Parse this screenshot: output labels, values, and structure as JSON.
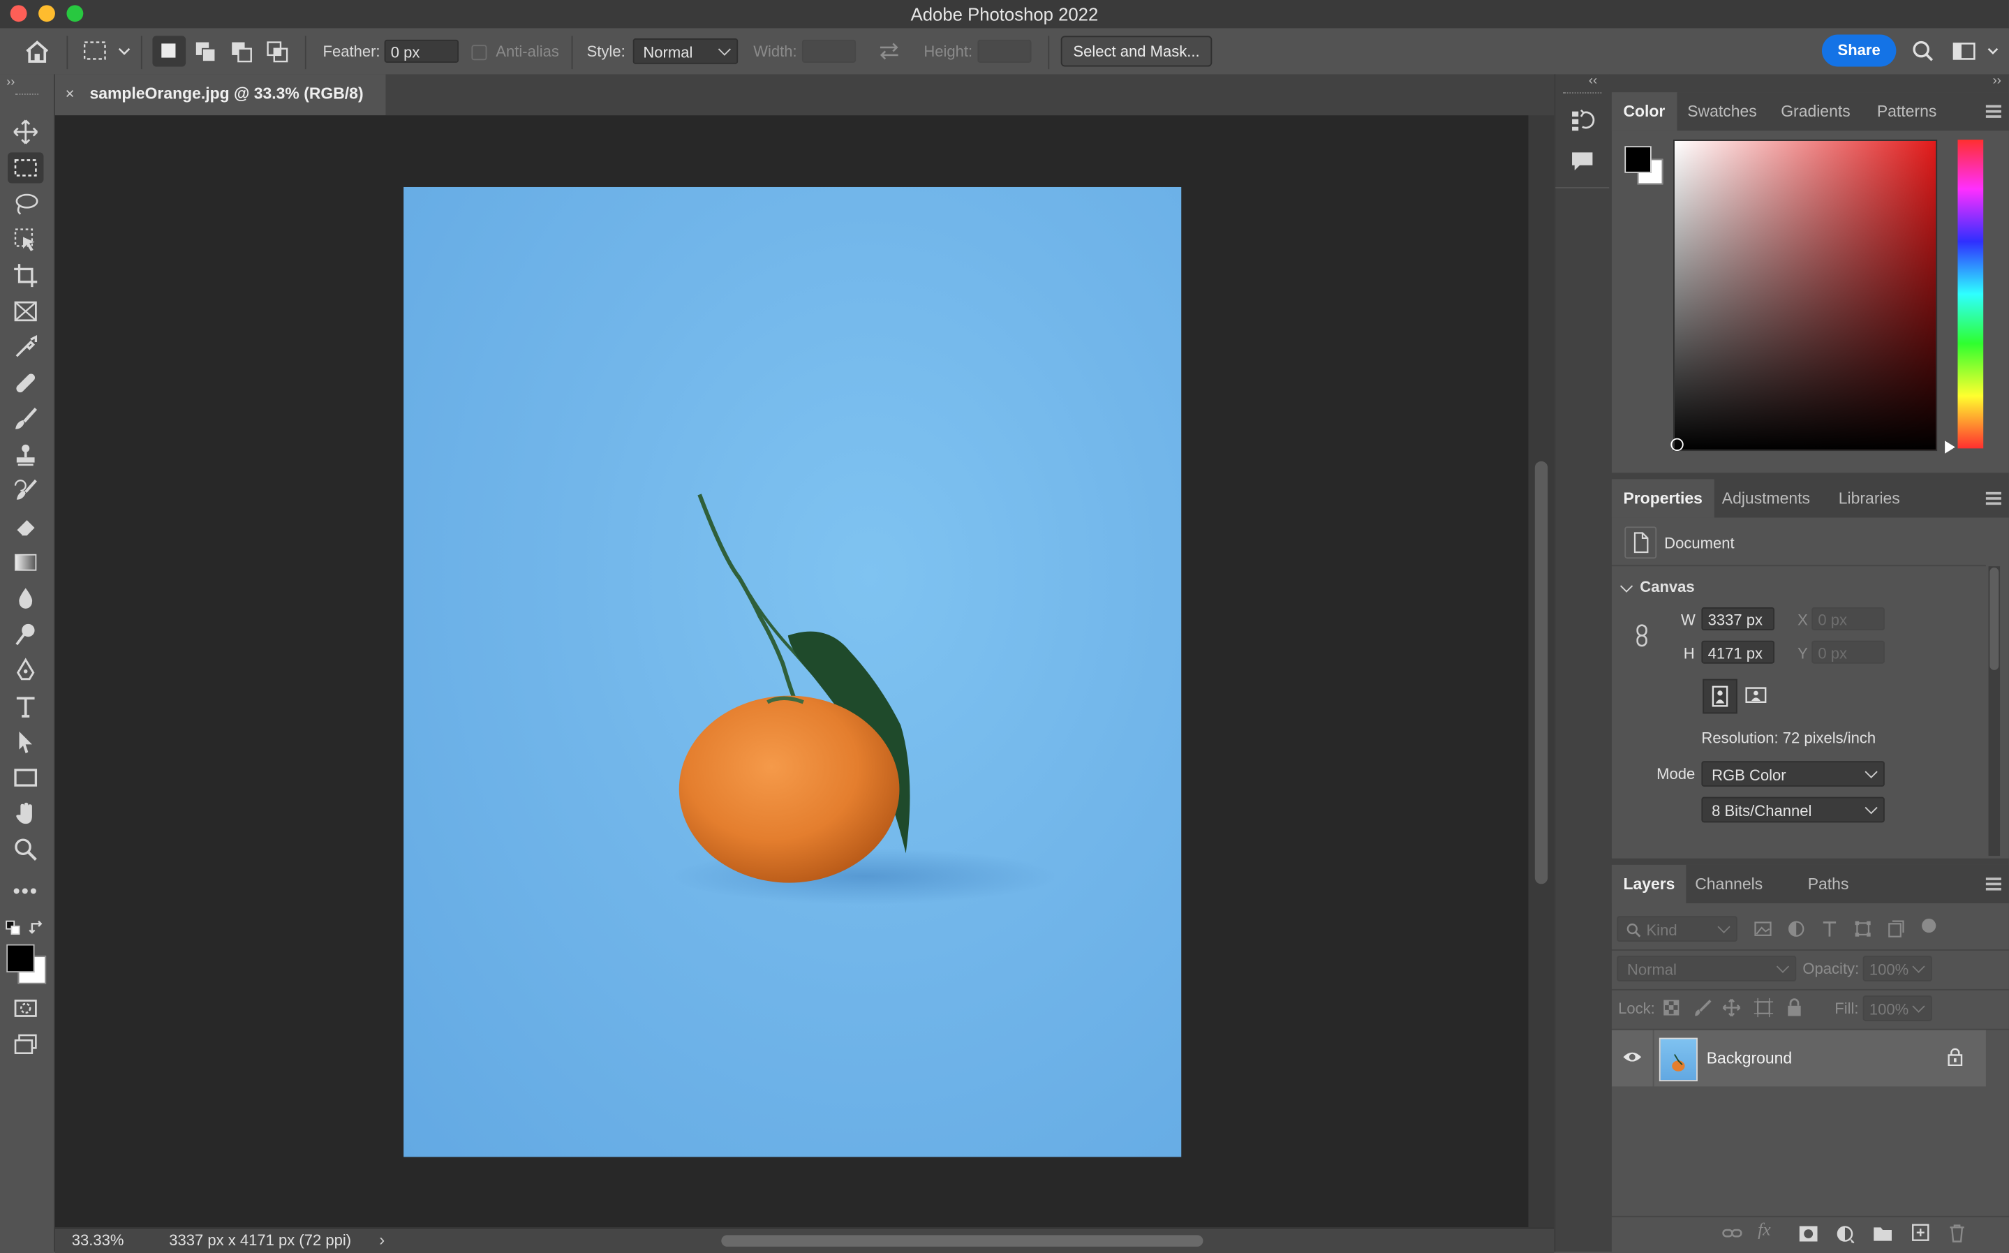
{
  "app_title": "Adobe Photoshop 2022",
  "options_bar": {
    "feather_label": "Feather:",
    "feather_value": "0 px",
    "anti_alias_label": "Anti-alias",
    "style_label": "Style:",
    "style_value": "Normal",
    "width_label": "Width:",
    "height_label": "Height:",
    "select_and_mask": "Select and Mask...",
    "share": "Share"
  },
  "document": {
    "tab_title": "sampleOrange.jpg @ 33.3% (RGB/8)",
    "zoom": "33.33%",
    "doc_info": "3337 px x 4171 px (72 ppi)"
  },
  "color_panel": {
    "tabs": [
      "Color",
      "Swatches",
      "Gradients",
      "Patterns"
    ]
  },
  "properties_panel": {
    "tabs": [
      "Properties",
      "Adjustments",
      "Libraries"
    ],
    "document_label": "Document",
    "canvas_label": "Canvas",
    "w_label": "W",
    "w_value": "3337 px",
    "h_label": "H",
    "h_value": "4171 px",
    "x_label": "X",
    "x_placeholder": "0 px",
    "y_label": "Y",
    "y_placeholder": "0 px",
    "resolution": "Resolution: 72 pixels/inch",
    "mode_label": "Mode",
    "mode_value": "RGB Color",
    "bits_value": "8 Bits/Channel"
  },
  "layers_panel": {
    "tabs": [
      "Layers",
      "Channels",
      "Paths"
    ],
    "kind_placeholder": "Kind",
    "blend_mode": "Normal",
    "opacity_label": "Opacity:",
    "opacity_value": "100%",
    "lock_label": "Lock:",
    "fill_label": "Fill:",
    "fill_value": "100%",
    "layers": [
      {
        "name": "Background",
        "visible": true,
        "locked": true
      }
    ]
  },
  "colors": {
    "accent": "#1473e6",
    "foreground": "#000000",
    "background": "#ffffff",
    "picker_hue": "#e21a1a"
  }
}
